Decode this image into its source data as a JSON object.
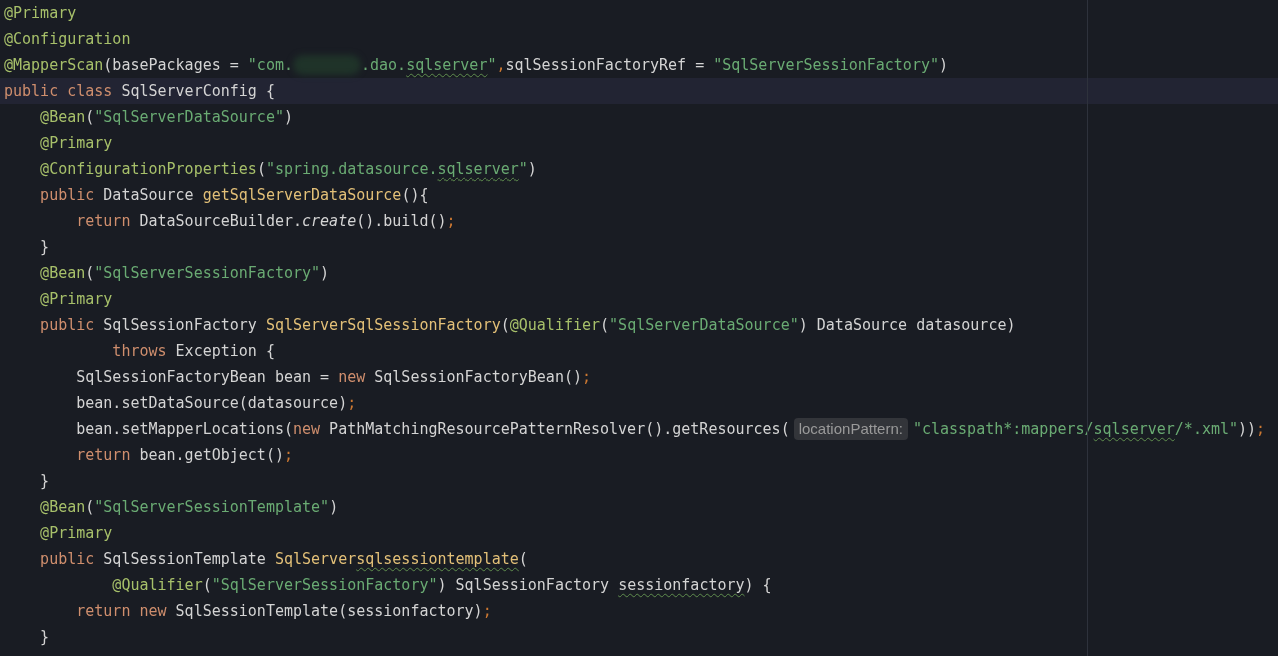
{
  "editor": {
    "lines": [
      {
        "current": false,
        "tokens": [
          {
            "kind": "ann",
            "text": "@Primary"
          }
        ]
      },
      {
        "current": false,
        "tokens": [
          {
            "kind": "ann",
            "text": "@Configuration"
          }
        ]
      },
      {
        "current": false,
        "tokens": [
          {
            "kind": "ann",
            "text": "@MapperScan"
          },
          {
            "kind": "plain",
            "text": "(basePackages = "
          },
          {
            "kind": "str",
            "text": "\"com."
          },
          {
            "kind": "redacted"
          },
          {
            "kind": "str",
            "text": ".dao."
          },
          {
            "kind": "str",
            "text": "sqlserver",
            "squiggly": true
          },
          {
            "kind": "str",
            "text": "\""
          },
          {
            "kind": "semi",
            "text": ","
          },
          {
            "kind": "plain",
            "text": "sqlSessionFactoryRef = "
          },
          {
            "kind": "str",
            "text": "\"SqlServerSessionFactory\""
          },
          {
            "kind": "plain",
            "text": ")"
          }
        ]
      },
      {
        "current": true,
        "tokens": [
          {
            "kind": "kw",
            "text": "public class "
          },
          {
            "kind": "plain",
            "text": "SqlServerConfig {"
          }
        ]
      },
      {
        "current": false,
        "tokens": [
          {
            "kind": "ann",
            "text": "    @Bean"
          },
          {
            "kind": "plain",
            "text": "("
          },
          {
            "kind": "str",
            "text": "\"SqlServerDataSource\""
          },
          {
            "kind": "plain",
            "text": ")"
          }
        ]
      },
      {
        "current": false,
        "tokens": [
          {
            "kind": "ann",
            "text": "    @Primary"
          }
        ]
      },
      {
        "current": false,
        "tokens": [
          {
            "kind": "ann",
            "text": "    @ConfigurationProperties"
          },
          {
            "kind": "plain",
            "text": "("
          },
          {
            "kind": "str",
            "text": "\"spring.datasource."
          },
          {
            "kind": "str",
            "text": "sqlserver",
            "squiggly": true
          },
          {
            "kind": "str",
            "text": "\""
          },
          {
            "kind": "plain",
            "text": ")"
          }
        ]
      },
      {
        "current": false,
        "tokens": [
          {
            "kind": "kw",
            "text": "    public "
          },
          {
            "kind": "plain",
            "text": "DataSource "
          },
          {
            "kind": "fn",
            "text": "getSqlServerDataSource"
          },
          {
            "kind": "plain",
            "text": "(){"
          }
        ]
      },
      {
        "current": false,
        "tokens": [
          {
            "kind": "kw",
            "text": "        return "
          },
          {
            "kind": "plain",
            "text": "DataSourceBuilder."
          },
          {
            "kind": "italic",
            "text": "create"
          },
          {
            "kind": "plain",
            "text": "().build()"
          },
          {
            "kind": "semi",
            "text": ";"
          }
        ]
      },
      {
        "current": false,
        "tokens": [
          {
            "kind": "plain",
            "text": "    }"
          }
        ]
      },
      {
        "current": false,
        "tokens": [
          {
            "kind": "ann",
            "text": "    @Bean"
          },
          {
            "kind": "plain",
            "text": "("
          },
          {
            "kind": "str",
            "text": "\"SqlServerSessionFactory\""
          },
          {
            "kind": "plain",
            "text": ")"
          }
        ]
      },
      {
        "current": false,
        "tokens": [
          {
            "kind": "ann",
            "text": "    @Primary"
          }
        ]
      },
      {
        "current": false,
        "tokens": [
          {
            "kind": "kw",
            "text": "    public "
          },
          {
            "kind": "plain",
            "text": "SqlSessionFactory "
          },
          {
            "kind": "fn",
            "text": "SqlServerSqlSessionFactory"
          },
          {
            "kind": "plain",
            "text": "("
          },
          {
            "kind": "ann",
            "text": "@Qualifier"
          },
          {
            "kind": "plain",
            "text": "("
          },
          {
            "kind": "str",
            "text": "\"SqlServerDataSource\""
          },
          {
            "kind": "plain",
            "text": ") DataSource datasource)"
          }
        ]
      },
      {
        "current": false,
        "tokens": [
          {
            "kind": "kw",
            "text": "            throws "
          },
          {
            "kind": "plain",
            "text": "Exception {"
          }
        ]
      },
      {
        "current": false,
        "tokens": [
          {
            "kind": "plain",
            "text": "        SqlSessionFactoryBean bean = "
          },
          {
            "kind": "kw",
            "text": "new "
          },
          {
            "kind": "plain",
            "text": "SqlSessionFactoryBean()"
          },
          {
            "kind": "semi",
            "text": ";"
          }
        ]
      },
      {
        "current": false,
        "tokens": [
          {
            "kind": "plain",
            "text": "        bean.setDataSource(datasource)"
          },
          {
            "kind": "semi",
            "text": ";"
          }
        ]
      },
      {
        "current": false,
        "tokens": [
          {
            "kind": "plain",
            "text": "        bean.setMapperLocations("
          },
          {
            "kind": "kw",
            "text": "new "
          },
          {
            "kind": "plain",
            "text": "PathMatchingResourcePatternResolver().getResources("
          },
          {
            "kind": "hint",
            "text": "locationPattern:"
          },
          {
            "kind": "str",
            "text": "\"classpath*:mappers/"
          },
          {
            "kind": "str",
            "text": "sqlserver",
            "squiggly": true
          },
          {
            "kind": "str",
            "text": "/*.xml\""
          },
          {
            "kind": "plain",
            "text": "))"
          },
          {
            "kind": "semi",
            "text": ";"
          }
        ]
      },
      {
        "current": false,
        "tokens": [
          {
            "kind": "kw",
            "text": "        return "
          },
          {
            "kind": "plain",
            "text": "bean.getObject()"
          },
          {
            "kind": "semi",
            "text": ";"
          }
        ]
      },
      {
        "current": false,
        "tokens": [
          {
            "kind": "plain",
            "text": "    }"
          }
        ]
      },
      {
        "current": false,
        "tokens": [
          {
            "kind": "ann",
            "text": "    @Bean"
          },
          {
            "kind": "plain",
            "text": "("
          },
          {
            "kind": "str",
            "text": "\"SqlServerSessionTemplate\""
          },
          {
            "kind": "plain",
            "text": ")"
          }
        ]
      },
      {
        "current": false,
        "tokens": [
          {
            "kind": "ann",
            "text": "    @Primary"
          }
        ]
      },
      {
        "current": false,
        "tokens": [
          {
            "kind": "kw",
            "text": "    public "
          },
          {
            "kind": "plain",
            "text": "SqlSessionTemplate "
          },
          {
            "kind": "fn",
            "text": "SqlServer"
          },
          {
            "kind": "fn",
            "text": "sqlsessiontemplate",
            "squiggly": true
          },
          {
            "kind": "plain",
            "text": "("
          }
        ]
      },
      {
        "current": false,
        "tokens": [
          {
            "kind": "ann",
            "text": "            @Qualifier"
          },
          {
            "kind": "plain",
            "text": "("
          },
          {
            "kind": "str",
            "text": "\"SqlServerSessionFactory\""
          },
          {
            "kind": "plain",
            "text": ") SqlSessionFactory "
          },
          {
            "kind": "plain",
            "text": "sessionfactory",
            "squiggly": true
          },
          {
            "kind": "plain",
            "text": ") {"
          }
        ]
      },
      {
        "current": false,
        "tokens": [
          {
            "kind": "kw",
            "text": "        return new "
          },
          {
            "kind": "plain",
            "text": "SqlSessionTemplate(sessionfactory)"
          },
          {
            "kind": "semi",
            "text": ";"
          }
        ]
      },
      {
        "current": false,
        "tokens": [
          {
            "kind": "plain",
            "text": "    }"
          }
        ]
      }
    ]
  }
}
